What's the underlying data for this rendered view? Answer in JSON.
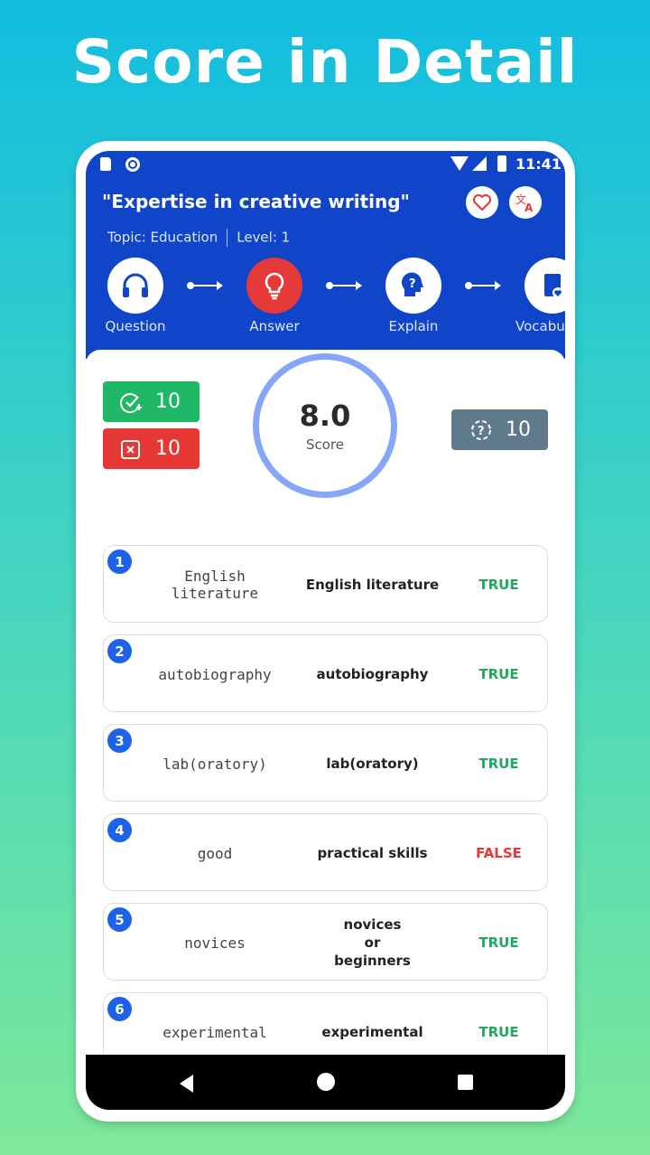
{
  "banner": {
    "headline": "Score in Detail"
  },
  "status_bar": {
    "time": "11:41"
  },
  "header": {
    "title": "\"Expertise in creative writing\"",
    "topic": "Topic: Education",
    "level": "Level: 1"
  },
  "steps": [
    {
      "label": "Question",
      "icon": "headphones-icon"
    },
    {
      "label": "Answer",
      "icon": "lightbulb-icon"
    },
    {
      "label": "Explain",
      "icon": "question-head-icon"
    },
    {
      "label": "Vocabu",
      "icon": "book-icon"
    }
  ],
  "summary": {
    "correct": "10",
    "wrong": "10",
    "unanswered": "10",
    "score": "8.0",
    "score_label": "Score"
  },
  "results": [
    {
      "num": "1",
      "answer": "English literature",
      "key": "English literature",
      "result": "TRUE"
    },
    {
      "num": "2",
      "answer": "autobiography",
      "key": "autobiography",
      "result": "TRUE"
    },
    {
      "num": "3",
      "answer": "lab(oratory)",
      "key": "lab(oratory)",
      "result": "TRUE"
    },
    {
      "num": "4",
      "answer": "good",
      "key": "practical skills",
      "result": "FALSE"
    },
    {
      "num": "5",
      "answer": "novices",
      "key": "novices\nor\nbeginners",
      "result": "TRUE"
    },
    {
      "num": "6",
      "answer": "experimental",
      "key": "experimental",
      "result": "TRUE"
    }
  ],
  "colors": {
    "header_blue": "#1045c9",
    "true_green": "#1fa85e",
    "false_red": "#e5383b",
    "ring_blue": "#86a6f7"
  }
}
